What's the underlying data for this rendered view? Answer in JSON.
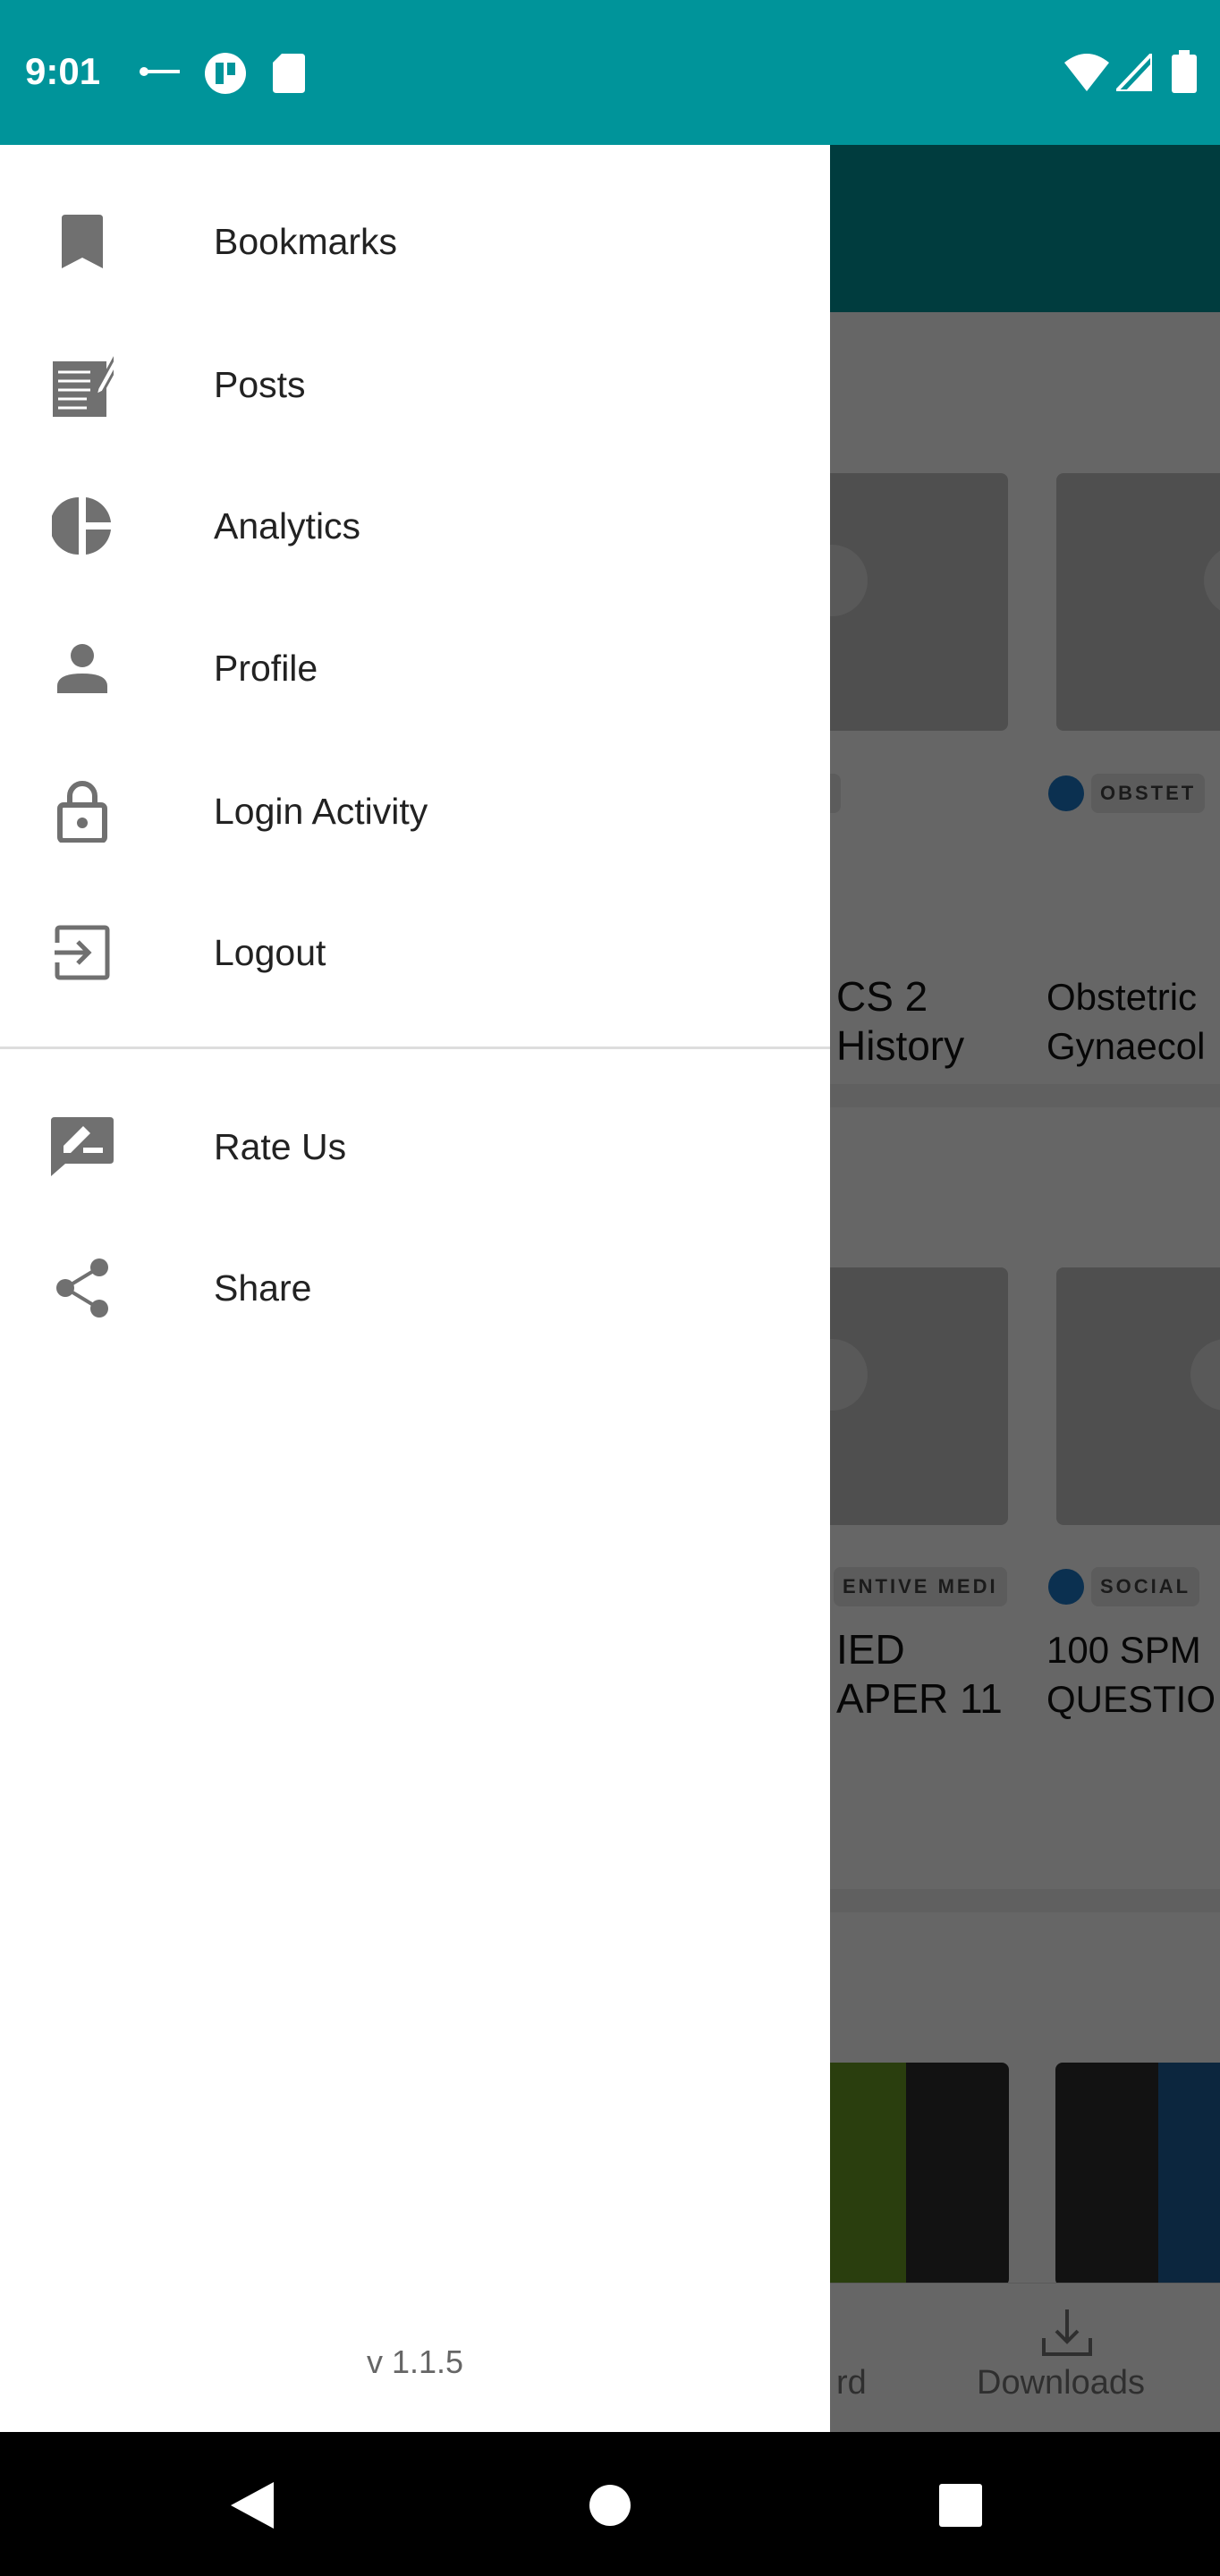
{
  "status_bar": {
    "time": "9:01",
    "icons": [
      "key-icon",
      "app-icon",
      "sd-card-icon",
      "wifi-icon",
      "signal-icon",
      "battery-icon"
    ]
  },
  "drawer": {
    "items": [
      {
        "label": "Bookmarks",
        "icon": "bookmark-icon"
      },
      {
        "label": "Posts",
        "icon": "posts-icon"
      },
      {
        "label": "Analytics",
        "icon": "pie-chart-icon"
      },
      {
        "label": "Profile",
        "icon": "person-icon"
      },
      {
        "label": "Login Activity",
        "icon": "lock-icon"
      },
      {
        "label": "Logout",
        "icon": "logout-icon"
      }
    ],
    "secondary_items": [
      {
        "label": "Rate Us",
        "icon": "rate-icon"
      },
      {
        "label": "Share",
        "icon": "share-icon"
      }
    ],
    "version": "v 1.1.5"
  },
  "background": {
    "cards_row1": [
      {
        "tag": "",
        "title": "CS 2\nHistory"
      },
      {
        "tag": "OBSTET",
        "title": "Obstetric\nGynaecol"
      }
    ],
    "cards_row2": [
      {
        "tag": "ENTIVE MEDI",
        "title": "IED\nAPER 11"
      },
      {
        "tag": "SOCIAL",
        "title": "100 SPM\nQUESTIO"
      }
    ],
    "bottom_nav": [
      {
        "label": "rd"
      },
      {
        "label": "Downloads"
      }
    ]
  },
  "colors": {
    "status_bar": "#00949a",
    "scrim": "rgba(0,0,0,0.6)",
    "badge": "#1b78c0"
  }
}
